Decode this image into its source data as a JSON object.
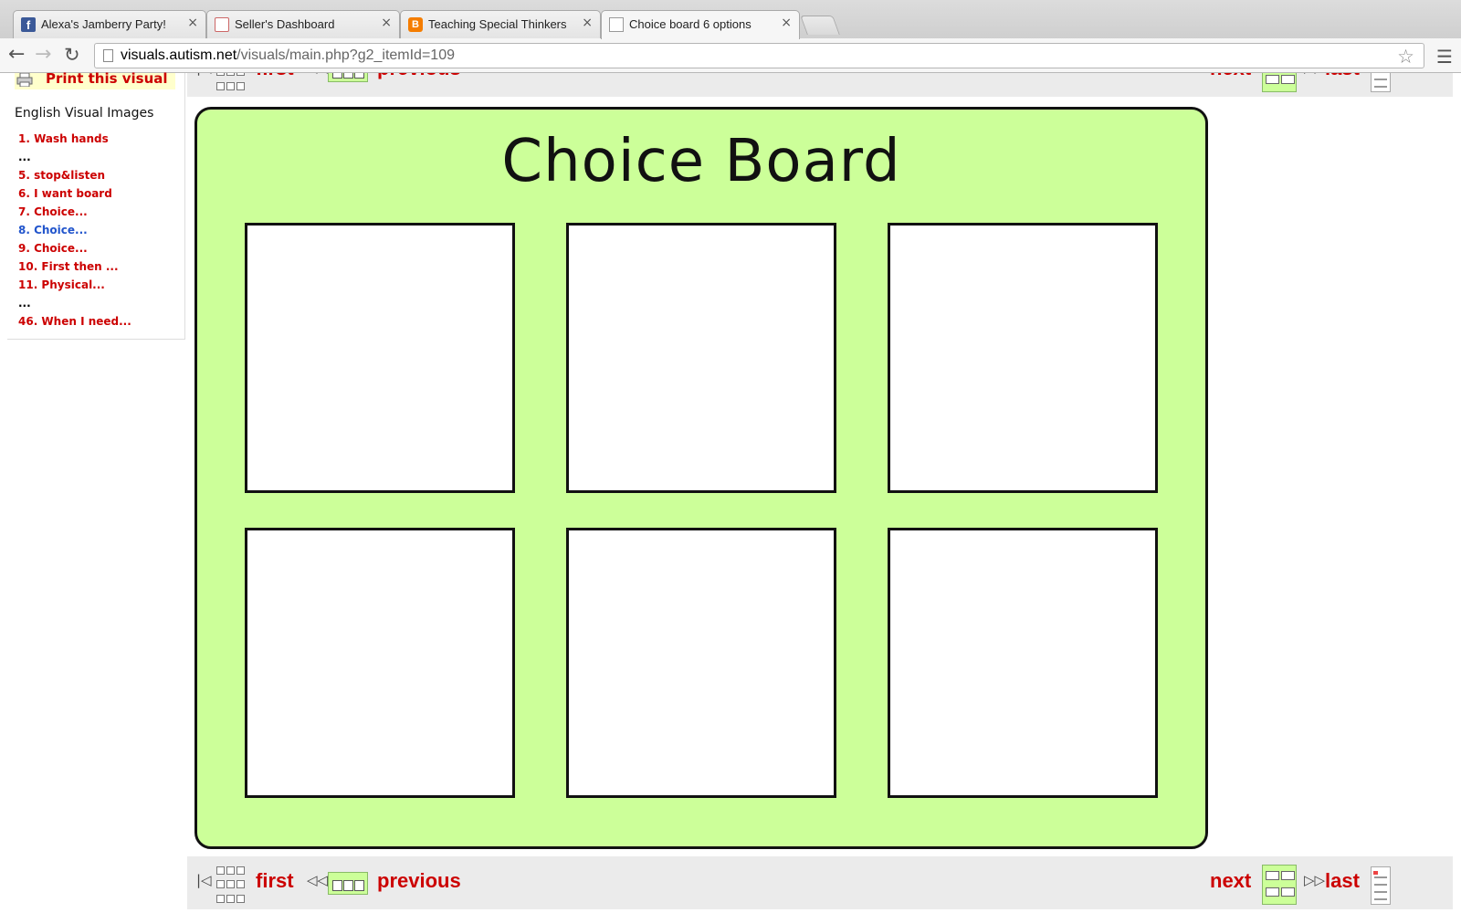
{
  "browser": {
    "tabs": [
      {
        "title": "Alexa's Jamberry Party!",
        "favicon": "facebook-icon",
        "active": false
      },
      {
        "title": "Seller's Dashboard",
        "favicon": "shop-icon",
        "active": false
      },
      {
        "title": "Teaching Special Thinkers",
        "favicon": "blogger-icon",
        "active": false
      },
      {
        "title": "Choice board 6 options",
        "favicon": "page-icon",
        "active": true
      }
    ],
    "close_glyph": "×",
    "url_domain": "visuals.autism.net",
    "url_path": "/visuals/main.php?g2_itemId=109"
  },
  "sidebar": {
    "print_label": "Print this visual",
    "heading": "English Visual Images",
    "items": [
      {
        "label": "1. Wash hands",
        "kind": "link"
      },
      {
        "label": "...",
        "kind": "ellipsis"
      },
      {
        "label": "5. stop&listen",
        "kind": "link"
      },
      {
        "label": "6. I want board",
        "kind": "link"
      },
      {
        "label": "7. Choice...",
        "kind": "link"
      },
      {
        "label": "8. Choice...",
        "kind": "current"
      },
      {
        "label": "9. Choice...",
        "kind": "link"
      },
      {
        "label": "10. First then ...",
        "kind": "link"
      },
      {
        "label": "11. Physical...",
        "kind": "link"
      },
      {
        "label": "...",
        "kind": "ellipsis"
      },
      {
        "label": "46. When I need...",
        "kind": "link"
      }
    ]
  },
  "pager": {
    "first": "first",
    "previous": "previous",
    "next": "next",
    "last": "last",
    "first_glyph": "|◁",
    "previous_glyph": "◁◁",
    "next_glyph": "▷▷"
  },
  "board": {
    "title": "Choice Board",
    "cell_count": 6,
    "background": "#ccff99"
  },
  "colors": {
    "link": "#cc0000",
    "current_link": "#2255cc",
    "print_highlight": "#ffffcc"
  }
}
